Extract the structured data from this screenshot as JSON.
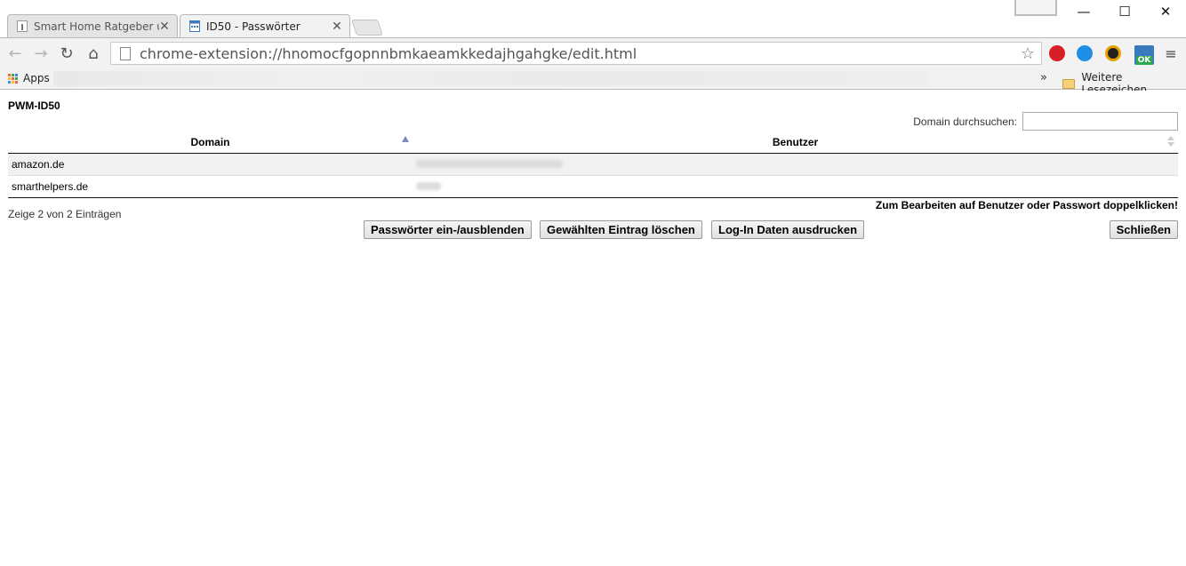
{
  "browser": {
    "tabs": [
      {
        "title": "Smart Home Ratgeber und",
        "close": "✕"
      },
      {
        "title": "ID50 - Passwörter",
        "close": "✕"
      }
    ],
    "window_controls": {
      "minimize": "—",
      "maximize": "☐",
      "close": "✕"
    },
    "url": "chrome-extension://hnomocfgopnnbmkaeamkkedajhgahgke/edit.html",
    "bookmarks": {
      "apps_label": "Apps",
      "overflow": "»",
      "other_label": "Weitere Lesezeichen"
    },
    "extension_badge": "OK"
  },
  "page": {
    "title": "PWM-ID50",
    "search_label": "Domain durchsuchen:",
    "search_value": "",
    "columns": [
      "Domain",
      "Benutzer"
    ],
    "rows": [
      {
        "domain": "amazon.de"
      },
      {
        "domain": "smarthelpers.de"
      }
    ],
    "info": "Zeige 2 von 2 Einträgen",
    "hint": "Zum Bearbeiten auf Benutzer oder Passwort doppelklicken!",
    "buttons": {
      "toggle_passwords": "Passwörter ein-/ausblenden",
      "delete_entry": "Gewählten Eintrag löschen",
      "print_login": "Log-In Daten ausdrucken",
      "close": "Schließen"
    }
  },
  "colors": {
    "sort_arrow": "#7f86b8",
    "row_stripe": "#f1f1f1"
  }
}
